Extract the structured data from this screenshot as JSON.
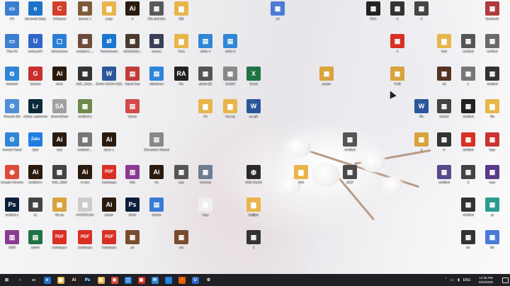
{
  "colors": {
    "taskbar_bg": "#1f1f24",
    "label_text": "#ffffff"
  },
  "desktop_icons": [
    {
      "label": "PC",
      "icon": "pc-icon",
      "color": "#3b7fd1",
      "glyph": "▭"
    },
    {
      "label": "Microsoft Edge",
      "icon": "edge-icon",
      "color": "#1e73c9",
      "glyph": "e"
    },
    {
      "label": "CCleaner",
      "icon": "ccleaner-icon",
      "color": "#d23f2a",
      "glyph": "C"
    },
    {
      "label": "banner 1",
      "icon": "image-icon",
      "color": "#7e5b3a",
      "glyph": "▦"
    },
    {
      "label": "Logo",
      "icon": "folder-icon",
      "color": "#e7b54a",
      "glyph": "▆"
    },
    {
      "label": "4",
      "icon": "ai-icon",
      "color": "#2b1b0e",
      "glyph": "Ai"
    },
    {
      "label": "tiểu phú bán",
      "icon": "image-icon",
      "color": "#5a5a5a",
      "glyph": "▦"
    },
    {
      "label": "Bất",
      "icon": "folder-icon",
      "color": "#e7b54a",
      "glyph": "▆"
    },
    {
      "label": "This PC",
      "icon": "this-pc-icon",
      "color": "#3b7fd1",
      "glyph": "▭"
    },
    {
      "label": "UniKeyNT",
      "icon": "unikey-icon",
      "color": "#2f66c8",
      "glyph": "U"
    },
    {
      "label": "UltraViewer",
      "icon": "ultraviewer-icon",
      "color": "#2a7fd4",
      "glyph": "▢"
    },
    {
      "label": "Untitled-1 ...",
      "icon": "image-icon",
      "color": "#6e4b3a",
      "glyph": "▦"
    },
    {
      "label": "TeamViewer",
      "icon": "teamviewer-icon",
      "color": "#1976d2",
      "glyph": "⇄"
    },
    {
      "label": "z20190916...",
      "icon": "image-icon",
      "color": "#4c3a2e",
      "glyph": "▦"
    },
    {
      "label": "cover1",
      "icon": "image-icon",
      "color": "#3a3f56",
      "glyph": "▦"
    },
    {
      "label": "Font",
      "icon": "folder-icon",
      "color": "#e7b54a",
      "glyph": "▆"
    },
    {
      "label": "slider 4",
      "icon": "file-icon",
      "color": "#2f86d6",
      "glyph": "▤"
    },
    {
      "label": "slider 6",
      "icon": "file-icon",
      "color": "#2f86d6",
      "glyph": "▤"
    },
    {
      "label": "Network",
      "icon": "network-icon",
      "color": "#2f86d6",
      "glyph": "⧉"
    },
    {
      "label": "Garena",
      "icon": "garena-icon",
      "color": "#c9302c",
      "glyph": "G"
    },
    {
      "label": "test1",
      "icon": "ai-icon",
      "color": "#2b1b0e",
      "glyph": "Ai"
    },
    {
      "label": "IMG_2019...",
      "icon": "image-icon",
      "color": "#333333",
      "glyph": "▦"
    },
    {
      "label": "DANH SÁCH HỌC",
      "icon": "word-icon",
      "color": "#2b579a",
      "glyph": "W"
    },
    {
      "label": "Game hay",
      "icon": "file-icon",
      "color": "#c43b3b",
      "glyph": "▤"
    },
    {
      "label": "slideshow",
      "icon": "file-icon",
      "color": "#2f86d6",
      "glyph": "▤"
    },
    {
      "label": "RA",
      "icon": "ra-icon",
      "color": "#222222",
      "glyph": "RA"
    },
    {
      "label": "photo (2)",
      "icon": "image-icon",
      "color": "#555555",
      "glyph": "▦"
    },
    {
      "label": "3c2d1f",
      "icon": "image-icon",
      "color": "#888888",
      "glyph": "▦"
    },
    {
      "label": "Excel",
      "icon": "excel-icon",
      "color": "#1f7244",
      "glyph": "X"
    },
    {
      "label": "Recycle Bin",
      "icon": "recycle-bin-icon",
      "color": "#4f8fd8",
      "glyph": "♻"
    },
    {
      "label": "Adobe Lightroom",
      "icon": "lightroom-icon",
      "color": "#0a2a3a",
      "glyph": "Lr"
    },
    {
      "label": "SmartAlbum",
      "icon": "smartalbum-icon",
      "color": "#a0a0a0",
      "glyph": "SA"
    },
    {
      "label": "Untitled-1",
      "icon": "image-icon",
      "color": "#6e8a4a",
      "glyph": "▦"
    },
    {
      "label": "Game",
      "icon": "file-icon",
      "color": "#d44a4a",
      "glyph": "▤"
    },
    {
      "label": "Ps",
      "icon": "folder-icon",
      "color": "#e7b54a",
      "glyph": "▆"
    },
    {
      "label": "Hot ep",
      "icon": "folder-icon",
      "color": "#e7b54a",
      "glyph": "▆"
    },
    {
      "label": "go gift",
      "icon": "word-icon",
      "color": "#2b579a",
      "glyph": "W"
    },
    {
      "label": "Control Panel",
      "icon": "control-panel-icon",
      "color": "#2f86d6",
      "glyph": "⚙"
    },
    {
      "label": "Zalo",
      "icon": "zalo-icon",
      "color": "#1f7fe0",
      "glyph": "Zalo"
    },
    {
      "label": "a1d",
      "icon": "ai-icon",
      "color": "#2b1b0e",
      "glyph": "Ai"
    },
    {
      "label": "Untitled-...",
      "icon": "image-icon",
      "color": "#777777",
      "glyph": "▦"
    },
    {
      "label": "bacK 1",
      "icon": "ai-icon",
      "color": "#2b1b0e",
      "glyph": "Ai"
    },
    {
      "label": "Elementor Wizard",
      "icon": "file-icon",
      "color": "#888888",
      "glyph": "▤"
    },
    {
      "label": "Google Chrome",
      "icon": "chrome-icon",
      "color": "#dd4b39",
      "glyph": "◉"
    },
    {
      "label": "Untitled-1",
      "icon": "ai-icon",
      "color": "#2b1b0e",
      "glyph": "Ai"
    },
    {
      "label": "IMG_2020",
      "icon": "image-icon",
      "color": "#444444",
      "glyph": "▦"
    },
    {
      "label": "Ai doc",
      "icon": "ai-icon",
      "color": "#2b1b0e",
      "glyph": "Ai"
    },
    {
      "label": "Catalogue",
      "icon": "pdf-icon",
      "color": "#d93025",
      "glyph": "PDF"
    },
    {
      "label": "bản",
      "icon": "winrar-icon",
      "color": "#8a3b8f",
      "glyph": "▥"
    },
    {
      "label": "ne",
      "icon": "ai-icon",
      "color": "#2b1b0e",
      "glyph": "Ai"
    },
    {
      "label": "ngs",
      "icon": "image-icon",
      "color": "#555555",
      "glyph": "▦"
    },
    {
      "label": "mockup",
      "icon": "image-icon",
      "color": "#6d7c8f",
      "glyph": "▦"
    },
    {
      "label": "OBS Studio",
      "icon": "obs-icon",
      "color": "#2a2a2a",
      "glyph": "◍"
    },
    {
      "label": "Untitled-1",
      "icon": "ps-icon",
      "color": "#0a1f3a",
      "glyph": "Ps"
    },
    {
      "label": "x1",
      "icon": "image-icon",
      "color": "#444444",
      "glyph": "▦"
    },
    {
      "label": "file ep",
      "icon": "image-icon",
      "color": "#d9a33d",
      "glyph": "▦"
    },
    {
      "label": "HYPERLINK",
      "icon": "image-icon",
      "color": "#cccccc",
      "glyph": "▦"
    },
    {
      "label": "poster",
      "icon": "ai-icon",
      "color": "#2b1b0e",
      "glyph": "Ai"
    },
    {
      "label": "slider",
      "icon": "ps-icon",
      "color": "#0a1f3a",
      "glyph": "Ps"
    },
    {
      "label": "SetMe",
      "icon": "file-icon",
      "color": "#3a7bd5",
      "glyph": "▤"
    },
    {
      "label": "logo",
      "icon": "image-icon",
      "color": "#eeeeee",
      "glyph": "▦"
    },
    {
      "label": "Lib",
      "icon": "winrar-icon",
      "color": "#8a3b8f",
      "glyph": "▥"
    },
    {
      "label": "2020",
      "icon": "winrar-icon",
      "color": "#8a3b8f",
      "glyph": "▥"
    },
    {
      "label": "admin",
      "icon": "file-icon",
      "color": "#1f7244",
      "glyph": "▤"
    },
    {
      "label": "Catalogue",
      "icon": "pdf-icon",
      "color": "#d93025",
      "glyph": "PDF"
    },
    {
      "label": "Catalogue",
      "icon": "pdf-icon",
      "color": "#d93025",
      "glyph": "PDF"
    },
    {
      "label": "Catalogue",
      "icon": "pdf-icon",
      "color": "#d93025",
      "glyph": "PDF"
    },
    {
      "label": "ps",
      "icon": "image-icon",
      "color": "#7a4c2e",
      "glyph": "▦"
    },
    {
      "label": "cot",
      "icon": "image-icon",
      "color": "#7a4c2e",
      "glyph": "▦"
    },
    {
      "label": "Banner",
      "icon": "folder-icon",
      "color": "#e7b54a",
      "glyph": "▆"
    },
    {
      "label": "2",
      "icon": "image-icon",
      "color": "#333333",
      "glyph": "▦"
    },
    {
      "label": "Ảnh",
      "icon": "folder-icon",
      "color": "#e7b54a",
      "glyph": "▆"
    },
    {
      "label": "2527",
      "icon": "image-icon",
      "color": "#4a4a4a",
      "glyph": "▦"
    },
    {
      "label": "DSC",
      "icon": "image-icon",
      "color": "#222222",
      "glyph": "▦"
    },
    {
      "label": "2",
      "icon": "image-icon",
      "color": "#333333",
      "glyph": "▦"
    },
    {
      "label": "poster",
      "icon": "image-icon",
      "color": "#d9a33d",
      "glyph": "▦"
    },
    {
      "label": "4",
      "icon": "image-icon",
      "color": "#d93025",
      "glyph": "▦"
    },
    {
      "label": "Thiết",
      "icon": "image-icon",
      "color": "#d9a33d",
      "glyph": "▦"
    },
    {
      "label": "2",
      "icon": "image-icon",
      "color": "#444444",
      "glyph": "▦"
    },
    {
      "label": "Untitled",
      "icon": "image-icon",
      "color": "#555555",
      "glyph": "▦"
    },
    {
      "label": "Untitled",
      "icon": "image-icon",
      "color": "#6a6a6a",
      "glyph": "▦"
    },
    {
      "label": "facebook",
      "icon": "image-icon",
      "color": "#b23b3b",
      "glyph": "▦"
    },
    {
      "label": "font",
      "icon": "folder-icon",
      "color": "#e7b54a",
      "glyph": "▆"
    },
    {
      "label": "1",
      "icon": "image-icon",
      "color": "#777777",
      "glyph": "▦"
    },
    {
      "label": "Untitled",
      "icon": "image-icon",
      "color": "#333333",
      "glyph": "▦"
    },
    {
      "label": "sd",
      "icon": "image-icon",
      "color": "#553322",
      "glyph": "▦"
    },
    {
      "label": "file",
      "icon": "folder-icon",
      "color": "#e7b54a",
      "glyph": "▆"
    },
    {
      "label": "file",
      "icon": "word-icon",
      "color": "#2b579a",
      "glyph": "W"
    },
    {
      "label": "Daniel",
      "icon": "image-icon",
      "color": "#444444",
      "glyph": "▦"
    },
    {
      "label": "Untitled",
      "icon": "image-icon",
      "color": "#222222",
      "glyph": "▦"
    },
    {
      "label": "Untitled",
      "icon": "image-icon",
      "color": "#555555",
      "glyph": "▦"
    },
    {
      "label": "2",
      "icon": "image-icon",
      "color": "#d9a33d",
      "glyph": "▦"
    },
    {
      "label": "b",
      "icon": "image-icon",
      "color": "#333333",
      "glyph": "▦"
    },
    {
      "label": "Untitled",
      "icon": "image-icon",
      "color": "#d93025",
      "glyph": "▦"
    },
    {
      "label": "logo",
      "icon": "image-icon",
      "color": "#cc3333",
      "glyph": "▦"
    },
    {
      "label": "Untitled",
      "icon": "image-icon",
      "color": "#5a4a8a",
      "glyph": "▦"
    },
    {
      "label": "2",
      "icon": "image-icon",
      "color": "#444444",
      "glyph": "▦"
    },
    {
      "label": "lose",
      "icon": "image-icon",
      "color": "#5a3a8a",
      "glyph": "▦"
    },
    {
      "label": "Untitled",
      "icon": "image-icon",
      "color": "#333333",
      "glyph": "▦"
    },
    {
      "label": "gr",
      "icon": "image-icon",
      "color": "#2a9d8f",
      "glyph": "▦"
    },
    {
      "label": "bo",
      "icon": "image-icon",
      "color": "#333333",
      "glyph": "▦"
    },
    {
      "label": "file",
      "icon": "image-icon",
      "color": "#4b7bd6",
      "glyph": "▦"
    },
    {
      "label": "sd",
      "icon": "image-icon",
      "color": "#4b7bd6",
      "glyph": "▦"
    }
  ],
  "taskbar": {
    "items": [
      {
        "icon": "start-icon",
        "color": "#1f1f24",
        "glyph": "⊞"
      },
      {
        "icon": "search-icon",
        "color": "#1f1f24",
        "glyph": "○"
      },
      {
        "icon": "task-view-icon",
        "color": "#1f1f24",
        "glyph": "▭"
      },
      {
        "icon": "edge-icon",
        "color": "#1e73c9",
        "glyph": "e"
      },
      {
        "icon": "file-explorer-icon",
        "color": "#e7b54a",
        "glyph": "▆"
      },
      {
        "icon": "illustrator-icon",
        "color": "#2b1b0e",
        "glyph": "Ai"
      },
      {
        "icon": "photoshop-icon",
        "color": "#0a1f3a",
        "glyph": "Ps"
      },
      {
        "icon": "store-icon",
        "color": "#e7b54a",
        "glyph": "▥"
      },
      {
        "icon": "chrome-icon",
        "color": "#dd4b39",
        "glyph": "◉"
      },
      {
        "icon": "ultraviewer-icon",
        "color": "#2a7fd4",
        "glyph": "▢"
      },
      {
        "icon": "paint-icon",
        "color": "#d93025",
        "glyph": "▦"
      },
      {
        "icon": "mail-icon",
        "color": "#2f86d6",
        "glyph": "✉"
      },
      {
        "icon": "chat-icon",
        "color": "#1f7fe0",
        "glyph": "◌"
      },
      {
        "icon": "firefox-icon",
        "color": "#e66000",
        "glyph": "◔"
      },
      {
        "icon": "unikey-icon",
        "color": "#2f66c8",
        "glyph": "U"
      },
      {
        "icon": "gear-icon",
        "color": "#1f1f24",
        "glyph": "⚙"
      }
    ],
    "language": "ENG",
    "time": "12:35 PM",
    "date": "6/24/2020"
  }
}
